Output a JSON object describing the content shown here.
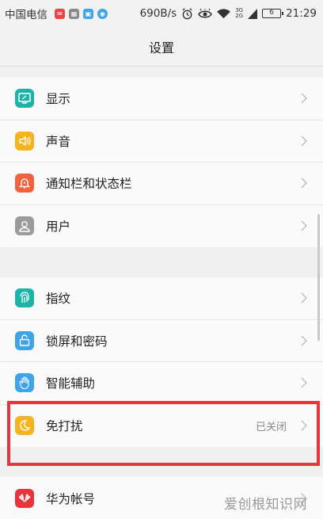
{
  "status_bar": {
    "carrier": "中国电信",
    "speed": "690B/s",
    "network_top": "3G",
    "network_bottom": "2G",
    "battery": "6",
    "time": "21:29"
  },
  "header": {
    "title": "设置"
  },
  "groups": [
    {
      "items": [
        {
          "label": "显示",
          "icon": "display-icon",
          "color": "#1bb5a8"
        },
        {
          "label": "声音",
          "icon": "sound-icon",
          "color": "#f5b41f"
        },
        {
          "label": "通知栏和状态栏",
          "icon": "notification-icon",
          "color": "#f2623e"
        },
        {
          "label": "用户",
          "icon": "user-icon",
          "color": "#9b9b9b"
        }
      ]
    },
    {
      "items": [
        {
          "label": "指纹",
          "icon": "fingerprint-icon",
          "color": "#1bb5a8"
        },
        {
          "label": "锁屏和密码",
          "icon": "lock-icon",
          "color": "#3fa3e8"
        },
        {
          "label": "智能辅助",
          "icon": "hand-icon",
          "color": "#3fa3e8"
        },
        {
          "label": "免打扰",
          "icon": "moon-icon",
          "color": "#f5b41f",
          "value": "已关闭"
        }
      ]
    },
    {
      "items": [
        {
          "label": "华为帐号",
          "icon": "huawei-icon",
          "color": "#e8353b"
        }
      ]
    }
  ],
  "watermark": "爱创根知识网"
}
